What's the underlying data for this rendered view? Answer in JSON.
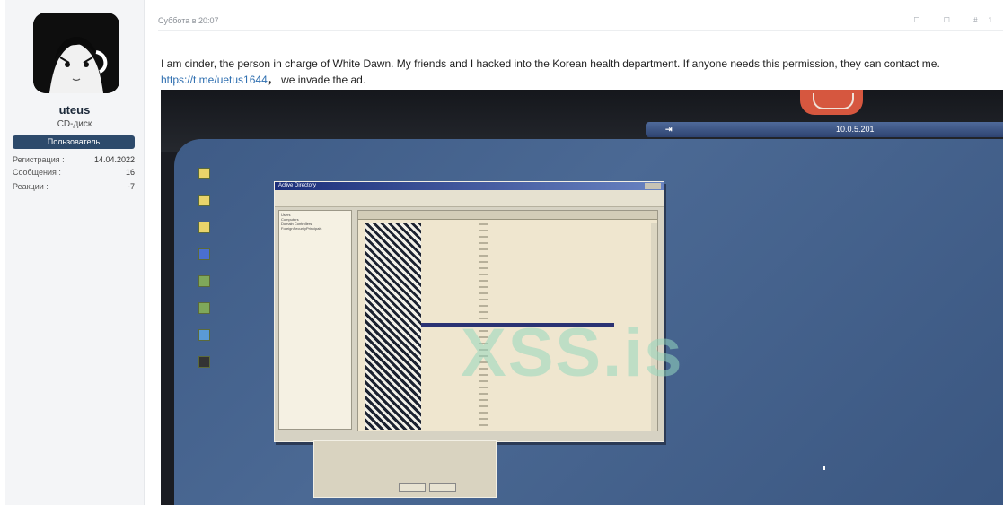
{
  "user": {
    "name": "uteus",
    "title": "CD-диск",
    "role": "Пользователь",
    "stats": [
      {
        "label": "Регистрация :",
        "value": "14.04.2022"
      },
      {
        "label": "Сообщения :",
        "value": "16"
      },
      {
        "label": "Реакции :",
        "value": "-7"
      }
    ]
  },
  "post": {
    "date": "Суббота в 20:07",
    "tools": "☐ ☐ #1",
    "text_before_link": "I am cinder, the person in charge of White Dawn. My friends and I hacked into the Korean health department. If anyone needs this permission, they can contact me. ",
    "link": "https://t.me/uetus1644",
    "text_after_link": "， we invade the ad."
  },
  "screenshot": {
    "remote_ip": "10.0.5.201",
    "remote_pin": "⇥",
    "window_title": "Active Directory",
    "watermark": "XSS.is",
    "tree_items": [
      "Users",
      "Computers",
      "Domain Controllers",
      "ForeignSecurityPrincipals"
    ]
  }
}
